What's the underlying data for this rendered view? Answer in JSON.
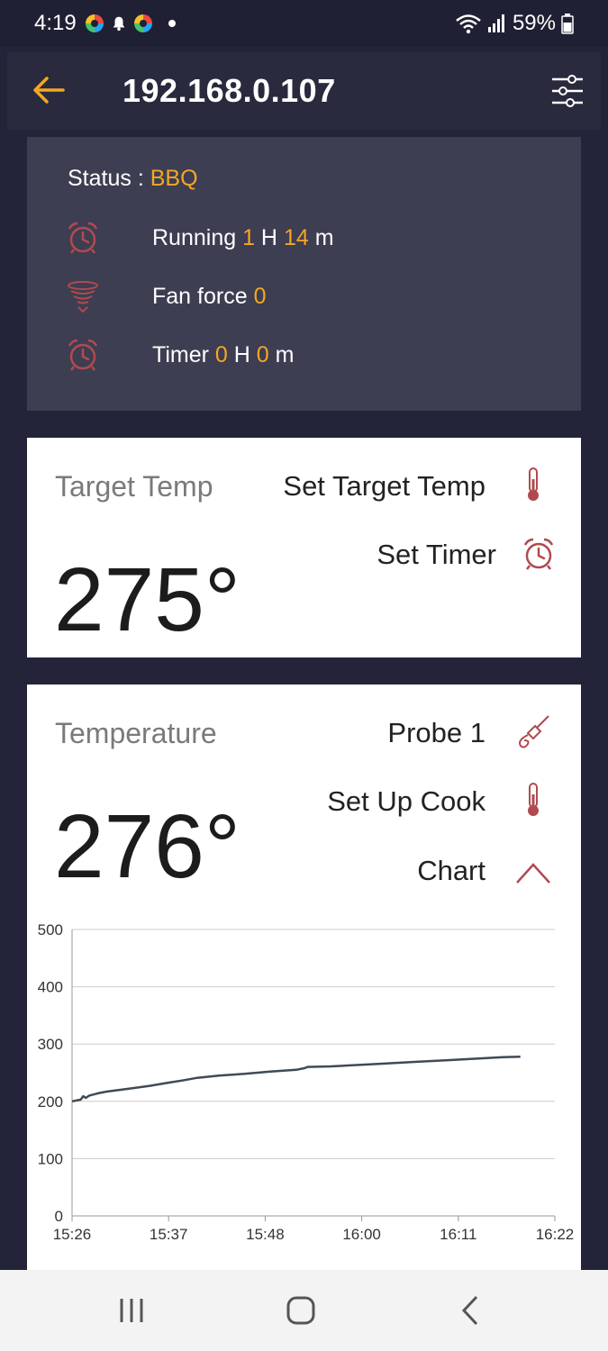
{
  "status_bar": {
    "time": "4:19",
    "battery": "59%"
  },
  "app_bar": {
    "title": "192.168.0.107",
    "back_icon": "back-arrow-icon",
    "settings_icon": "sliders-icon"
  },
  "status": {
    "label": "Status : ",
    "value": "BBQ",
    "running": {
      "label": "Running ",
      "hours": "1",
      "h_unit": " H ",
      "minutes": "14",
      "m_unit": " m"
    },
    "fan": {
      "label": "Fan force ",
      "value": "0"
    },
    "timer": {
      "label": "Timer ",
      "hours": "0",
      "h_unit": " H ",
      "minutes": "0",
      "m_unit": " m"
    }
  },
  "target_card": {
    "label": "Target Temp",
    "value": "275°",
    "set_target_label": "Set Target Temp",
    "set_timer_label": "Set Timer"
  },
  "temp_card": {
    "label": "Temperature",
    "value": "276°",
    "probe_label": "Probe 1",
    "setup_label": "Set Up Cook",
    "chart_label": "Chart"
  },
  "colors": {
    "accent": "#f5a623",
    "icon_red": "#b04a4f",
    "background": "#23243a",
    "status_card": "#3d3e52",
    "line": "#3f4a55"
  },
  "chart_data": {
    "type": "line",
    "x_ticks": [
      "15:26",
      "15:37",
      "15:48",
      "16:00",
      "16:11",
      "16:22"
    ],
    "y_ticks": [
      "0",
      "100",
      "200",
      "300",
      "400",
      "500"
    ],
    "ylim": [
      0,
      500
    ],
    "xlim_minutes": [
      0,
      56
    ],
    "grid": true,
    "series": [
      {
        "x_minutes": [
          0,
          1,
          1.3,
          1.6,
          2,
          3,
          4,
          5,
          7,
          9,
          11,
          13,
          14.5,
          17,
          20,
          23,
          26,
          27,
          27.3,
          30,
          35,
          40,
          45,
          50,
          52
        ],
        "y": [
          200,
          203,
          209,
          206,
          210,
          214,
          217,
          219,
          223,
          227,
          232,
          237,
          241,
          245,
          248,
          252,
          255,
          258,
          260,
          261,
          265,
          269,
          273,
          277,
          278
        ]
      }
    ]
  },
  "nav_bar": {
    "recents_icon": "recents-icon",
    "home_icon": "home-icon",
    "back_icon": "nav-back-icon"
  }
}
